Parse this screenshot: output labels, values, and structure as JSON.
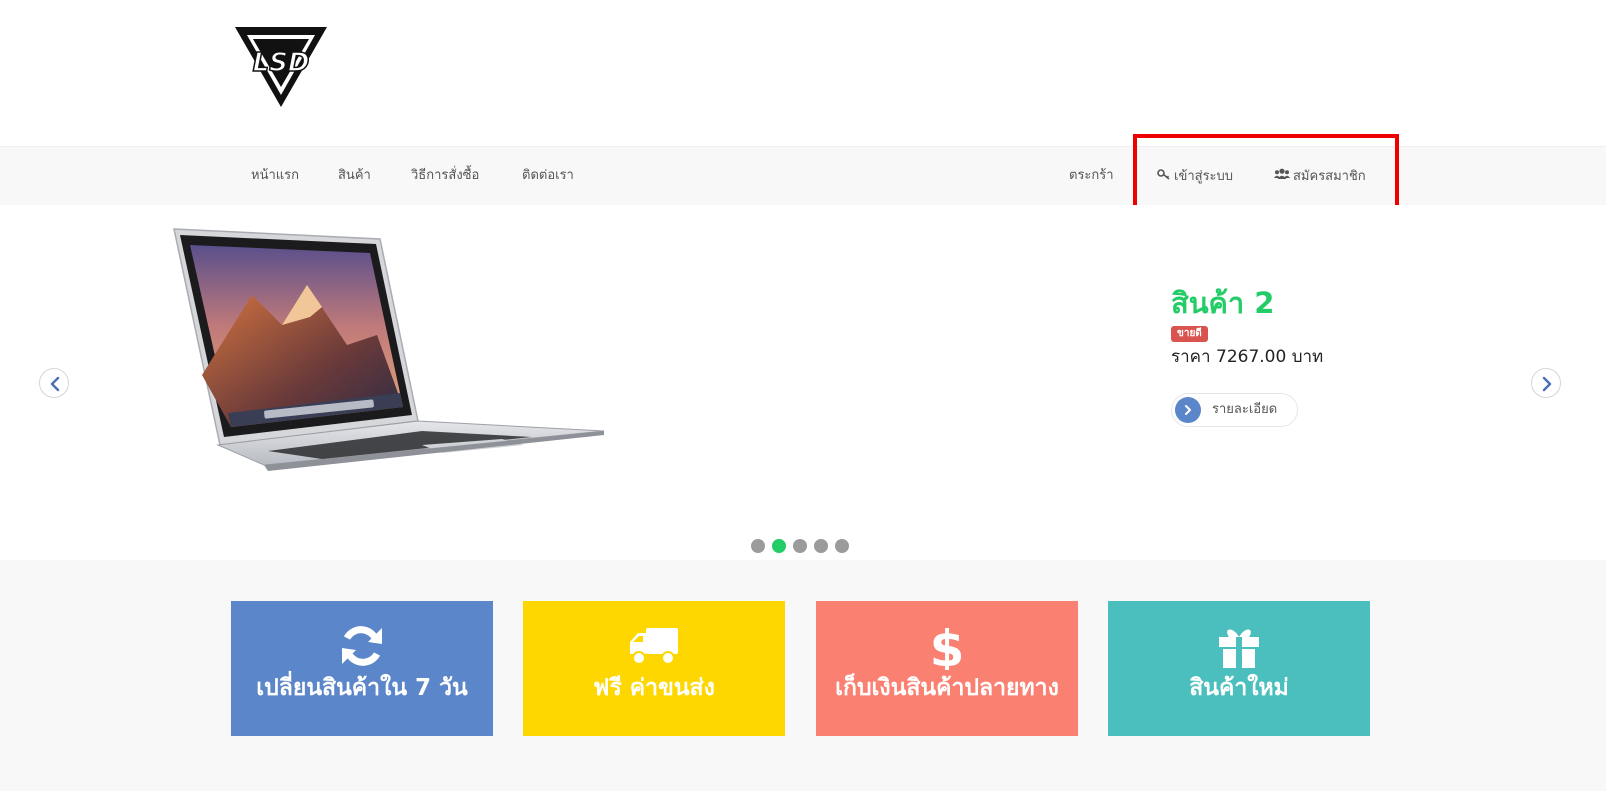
{
  "brand": {
    "logo_text": "LSD"
  },
  "nav": {
    "left": [
      {
        "label": "หน้าแรก"
      },
      {
        "label": "สินค้า"
      },
      {
        "label": "วิธีการสั่งซื้อ"
      },
      {
        "label": "ติดต่อเรา"
      }
    ],
    "cart_label": "ตระกร้า",
    "login_label": "เข้าสู่ระบบ",
    "register_label": "สมัครสมาชิก"
  },
  "carousel": {
    "product_title": "สินค้า 2",
    "badge": "ขายดี",
    "price": "ราคา 7267.00 บาท",
    "detail_button": "รายละเอียด",
    "slide_count": 5,
    "active_slide": 2
  },
  "features": [
    {
      "label": "เปลี่ยนสินค้าใน 7 วัน",
      "icon": "refresh-icon",
      "color": "#5b86c9"
    },
    {
      "label": "ฟรี ค่าขนส่ง",
      "icon": "truck-icon",
      "color": "#ffd700"
    },
    {
      "label": "เก็บเงินสินค้าปลายทาง",
      "icon": "dollar-icon",
      "color": "#fa8072"
    },
    {
      "label": "สินค้าใหม่",
      "icon": "gift-icon",
      "color": "#4abfbd"
    }
  ],
  "colors": {
    "accent_green": "#22cc66",
    "badge_red": "#d9534f",
    "highlight_red": "#ee0000"
  }
}
